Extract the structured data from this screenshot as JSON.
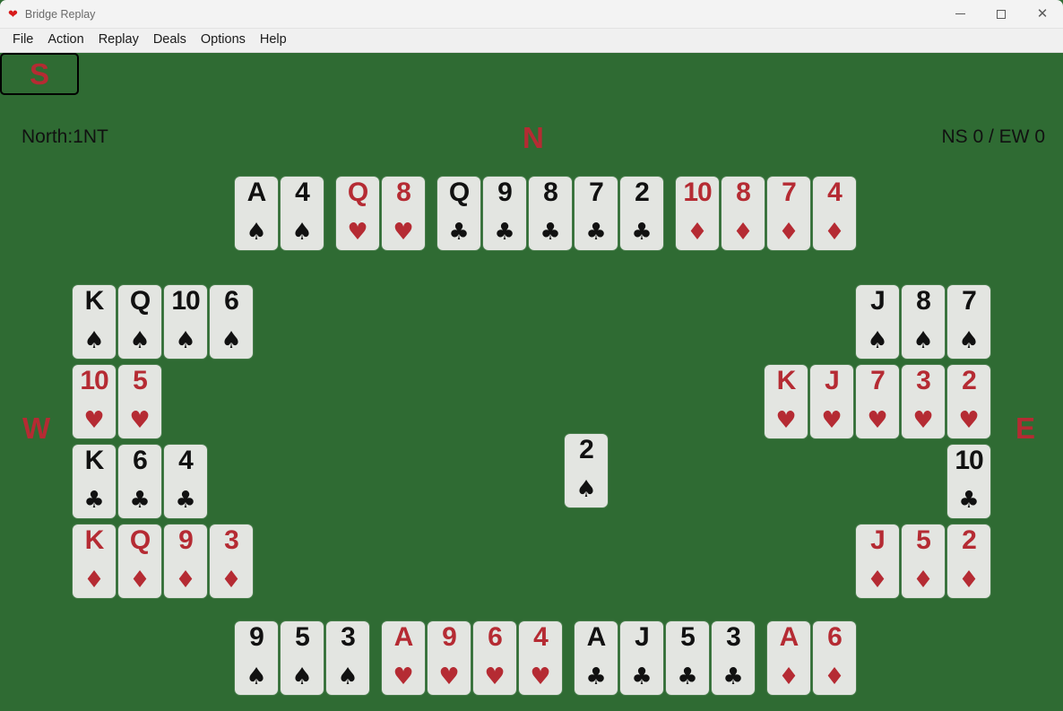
{
  "window": {
    "title": "Bridge Replay",
    "icon": "heart-icon",
    "controls": {
      "minimize": "–",
      "maximize": "□",
      "close": "✕"
    }
  },
  "menu": {
    "items": [
      "File",
      "Action",
      "Replay",
      "Deals",
      "Options",
      "Help"
    ]
  },
  "table": {
    "contract": "North:1NT",
    "score": "NS 0 / EW 0",
    "felt_color": "#2f6b33",
    "red_color": "#b52b33",
    "black_color": "#111111",
    "card_face_color": "#e3e5e1"
  },
  "compass": {
    "north": "N",
    "south": "S",
    "east": "E",
    "west": "W",
    "active_seat": "S"
  },
  "suits": {
    "spade": "♠",
    "heart": "♥",
    "club": "♣",
    "diamond": "♦"
  },
  "hands": {
    "north": {
      "seat": "North",
      "rows": [
        {
          "groups": [
            {
              "suit": "spade",
              "color": "black",
              "ranks": [
                "A",
                "4"
              ]
            },
            {
              "suit": "heart",
              "color": "red",
              "ranks": [
                "Q",
                "8"
              ]
            },
            {
              "suit": "club",
              "color": "black",
              "ranks": [
                "Q",
                "9",
                "8",
                "7",
                "2"
              ]
            },
            {
              "suit": "diamond",
              "color": "red",
              "ranks": [
                "10",
                "8",
                "7",
                "4"
              ]
            }
          ]
        }
      ]
    },
    "west": {
      "seat": "West",
      "rows": [
        {
          "groups": [
            {
              "suit": "spade",
              "color": "black",
              "ranks": [
                "K",
                "Q",
                "10",
                "6"
              ]
            }
          ]
        },
        {
          "groups": [
            {
              "suit": "heart",
              "color": "red",
              "ranks": [
                "10",
                "5"
              ]
            }
          ]
        },
        {
          "groups": [
            {
              "suit": "club",
              "color": "black",
              "ranks": [
                "K",
                "6",
                "4"
              ]
            }
          ]
        },
        {
          "groups": [
            {
              "suit": "diamond",
              "color": "red",
              "ranks": [
                "K",
                "Q",
                "9",
                "3"
              ]
            }
          ]
        }
      ]
    },
    "east": {
      "seat": "East",
      "rows": [
        {
          "groups": [
            {
              "suit": "spade",
              "color": "black",
              "ranks": [
                "J",
                "8",
                "7"
              ]
            }
          ]
        },
        {
          "groups": [
            {
              "suit": "heart",
              "color": "red",
              "ranks": [
                "K",
                "J",
                "7",
                "3",
                "2"
              ]
            }
          ]
        },
        {
          "groups": [
            {
              "suit": "club",
              "color": "black",
              "ranks": [
                "10"
              ]
            }
          ]
        },
        {
          "groups": [
            {
              "suit": "diamond",
              "color": "red",
              "ranks": [
                "J",
                "5",
                "2"
              ]
            }
          ]
        }
      ]
    },
    "south": {
      "seat": "South",
      "rows": [
        {
          "groups": [
            {
              "suit": "spade",
              "color": "black",
              "ranks": [
                "9",
                "5",
                "3"
              ]
            },
            {
              "suit": "heart",
              "color": "red",
              "ranks": [
                "A",
                "9",
                "6",
                "4"
              ]
            },
            {
              "suit": "club",
              "color": "black",
              "ranks": [
                "A",
                "J",
                "5",
                "3"
              ]
            },
            {
              "suit": "diamond",
              "color": "red",
              "ranks": [
                "A",
                "6"
              ]
            }
          ]
        }
      ]
    }
  },
  "trick": {
    "cards": [
      {
        "seat": "East",
        "rank": "2",
        "suit": "spade",
        "color": "black"
      }
    ]
  }
}
